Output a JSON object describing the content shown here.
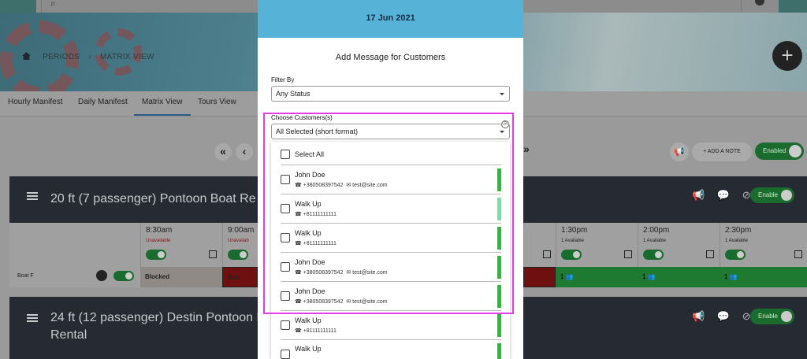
{
  "background": {
    "breadcrumb": {
      "first": "PERIODS",
      "current": "MATRIX VIEW"
    },
    "tabs": [
      "Hourly Manifest",
      "Daily Manifest",
      "Matrix View",
      "Tours View"
    ],
    "active_tab": "Matrix View",
    "nav": {
      "first": "«",
      "prev": "‹",
      "next": "»"
    },
    "toolbar": {
      "add_note": "+ ADD A NOTE",
      "enabled": "Enabled"
    },
    "boats": [
      {
        "title": "20 ft (7 passenger) Pontoon Boat Re",
        "enable": "Enable"
      },
      {
        "title_line1": "24 ft (12 passenger) Destin Pontoon Bo",
        "title_line2": "Rental",
        "enable": "Enable"
      }
    ],
    "slots": [
      {
        "time": "8:30am",
        "status": "Unavailable"
      },
      {
        "time": "9:00am",
        "status": "Unavailab"
      },
      {
        "time": "1:30pm",
        "status": "1 Available"
      },
      {
        "time": "2:00pm",
        "status": "1 Available"
      },
      {
        "time": "2:30pm",
        "status": "1 Available"
      }
    ],
    "boat_row": {
      "label": "Boat F",
      "cells": [
        "Blocked",
        "Boo",
        "1",
        "1",
        "1"
      ]
    }
  },
  "modal": {
    "date": "17 Jun 2021",
    "title": "Add Message for Customers",
    "filter_label": "Filter By",
    "filter_value": "Any Status",
    "customers_label": "Choose Customers(s)",
    "customers_value": "All Selected (short format)",
    "help": "?",
    "select_all": "Select All",
    "customers": [
      {
        "name": "John Doe",
        "phone": "☎ +380508397542",
        "email": "✉ test@site.com",
        "bar": "green"
      },
      {
        "name": "Walk Up",
        "phone": "☎ +81111111111",
        "email": "",
        "bar": "light"
      },
      {
        "name": "Walk Up",
        "phone": "☎ +81111111111",
        "email": "",
        "bar": "green"
      },
      {
        "name": "John Doe",
        "phone": "☎ +380508397542",
        "email": "✉ test@site.com",
        "bar": "green"
      },
      {
        "name": "John Doe",
        "phone": "☎ +380508397542",
        "email": "✉ test@site.com",
        "bar": "green"
      },
      {
        "name": "Walk Up",
        "phone": "☎ +81111111111",
        "email": "",
        "bar": "green"
      },
      {
        "name": "Walk Up",
        "phone": "",
        "email": "",
        "bar": "green"
      }
    ]
  }
}
